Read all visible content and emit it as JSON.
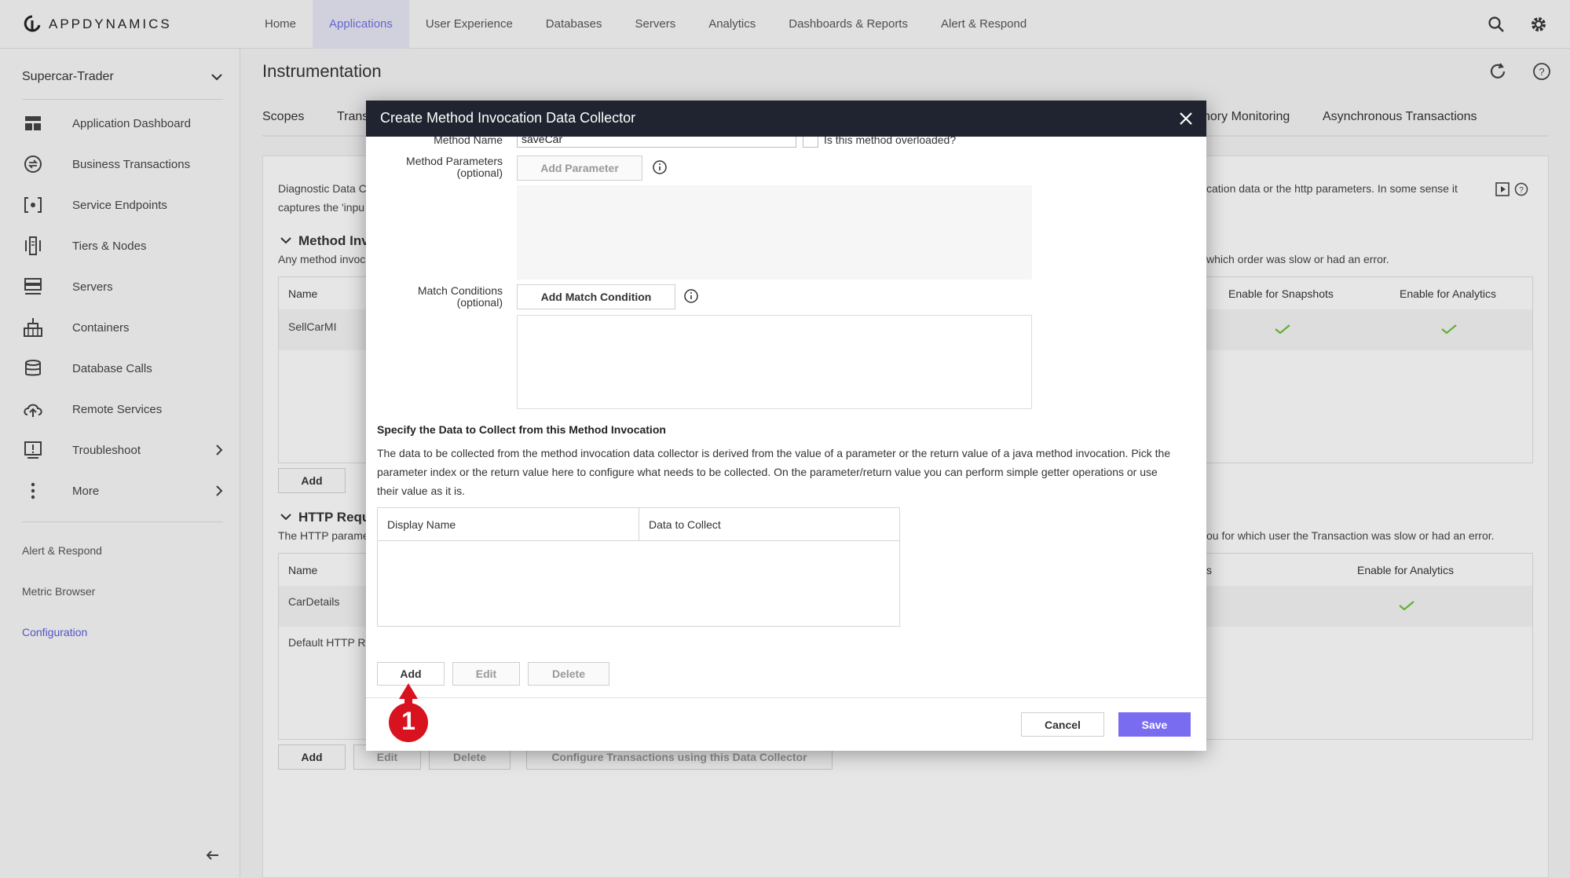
{
  "brand": {
    "name": "APPDYNAMICS"
  },
  "nav": {
    "items": [
      "Home",
      "Applications",
      "User Experience",
      "Databases",
      "Servers",
      "Analytics",
      "Dashboards & Reports",
      "Alert & Respond"
    ],
    "active": "Applications"
  },
  "sidebar": {
    "app_name": "Supercar-Trader",
    "items": [
      {
        "label": "Application Dashboard",
        "icon": "dashboard-icon"
      },
      {
        "label": "Business Transactions",
        "icon": "transactions-icon"
      },
      {
        "label": "Service Endpoints",
        "icon": "service-endpoint-icon"
      },
      {
        "label": "Tiers & Nodes",
        "icon": "tiers-icon"
      },
      {
        "label": "Servers",
        "icon": "servers-icon"
      },
      {
        "label": "Containers",
        "icon": "containers-icon"
      },
      {
        "label": "Database Calls",
        "icon": "database-icon"
      },
      {
        "label": "Remote Services",
        "icon": "cloud-upload-icon"
      },
      {
        "label": "Troubleshoot",
        "icon": "alert-box-icon"
      },
      {
        "label": "More",
        "icon": "more-vertical-icon"
      }
    ],
    "links": [
      "Alert & Respond",
      "Metric Browser",
      "Configuration"
    ],
    "active_link": "Configuration"
  },
  "main": {
    "title": "Instrumentation",
    "tabs": [
      "Scopes",
      "Trans",
      "nory Monitoring",
      "Asynchronous Transactions"
    ],
    "desc_left_1": "Diagnostic Data C",
    "desc_left_2": "captures the 'inpu",
    "desc_right": "cation data or the http parameters. In some sense it",
    "section1_title": "Method Inv",
    "section1_desc_left": "Any method invoc",
    "section1_desc_right": "which order was slow or had an error.",
    "table1": {
      "col_name": "Name",
      "col_snapshots": "Enable for Snapshots",
      "col_analytics": "Enable for Analytics",
      "row1": "SellCarMI"
    },
    "add_label": "Add",
    "section2_title": "HTTP Requ",
    "section2_desc_left": "The HTTP parame",
    "section2_desc_right": "ou for which user the Transaction was slow or had an error.",
    "table2": {
      "col_name": "Name",
      "col_s": "s",
      "col_analytics": "Enable for Analytics",
      "row1": "CarDetails",
      "row2": "Default HTTP R"
    },
    "bottom_buttons": [
      "Add",
      "Edit",
      "Delete",
      "Configure Transactions using this Data Collector"
    ]
  },
  "modal": {
    "title": "Create Method Invocation Data Collector",
    "method_name_label": "Method Name",
    "method_name_value": "saveCar",
    "overloaded_label": "Is this method overloaded?",
    "method_params_label": "Method Parameters",
    "optional": "(optional)",
    "add_parameter": "Add Parameter",
    "match_conditions_label": "Match Conditions",
    "add_match_condition": "Add Match Condition",
    "specify_heading": "Specify the Data to Collect from this Method Invocation",
    "specify_para_1": "The data to be collected from the method invocation data collector is derived from the value of a parameter or the return value of a java method invocation. Pick the",
    "specify_para_2": "parameter index or the return value here to configure what needs to be collected. On the parameter/return value you can perform simple getter operations or use",
    "specify_para_3": "their value as it is.",
    "table": {
      "col_display_name": "Display Name",
      "col_data": "Data to Collect"
    },
    "add": "Add",
    "edit": "Edit",
    "delete": "Delete",
    "cancel": "Cancel",
    "save": "Save"
  },
  "callout": {
    "number": "1"
  },
  "colors": {
    "accent": "#7a6cf0",
    "header": "#1f2430",
    "check": "#6abf3a",
    "callout": "#d9121f"
  }
}
